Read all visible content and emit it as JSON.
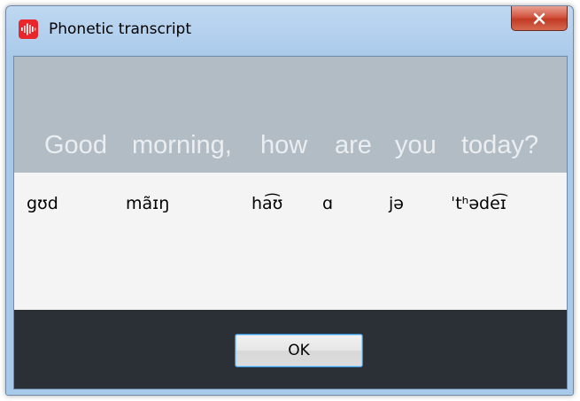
{
  "window": {
    "title": "Phonetic transcript",
    "icon": "audio-waveform-icon",
    "close_icon": "close-icon"
  },
  "sentence": {
    "words": [
      "Good",
      "morning,",
      "how",
      "are",
      "you",
      "today?"
    ]
  },
  "transcript": {
    "words": [
      "gʊd",
      "mãɪŋ",
      "ha͡ʊ",
      "ɑ",
      "jə",
      "ˈtʰəde͡ɪ"
    ]
  },
  "footer": {
    "ok_label": "OK"
  },
  "colors": {
    "sentence_bg": "#b2bcc4",
    "sentence_text": "#eaeef1",
    "transcript_bg": "#f4f4f4",
    "footer_bg": "#2a3036",
    "app_icon": "#e8262c",
    "close_button": "#c23a24",
    "ok_border": "#3c8fd1"
  }
}
